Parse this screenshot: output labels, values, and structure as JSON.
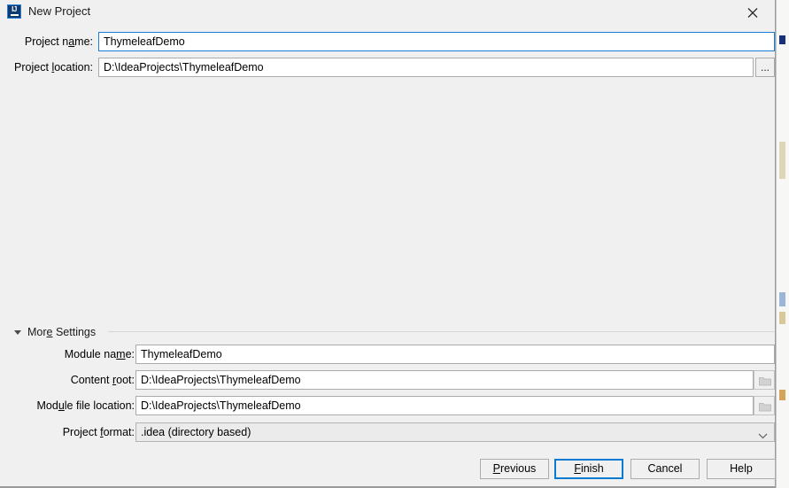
{
  "window": {
    "title": "New Project",
    "icon": "intellij-idea-icon",
    "close_icon": "close-icon",
    "background_color": "#f0f0f0",
    "accent_color": "#0a7ad1"
  },
  "top_fields": [
    {
      "label_before": "Project n",
      "label_mnemonic": "a",
      "label_after": "me:",
      "value": "ThymeleafDemo",
      "focused": true
    },
    {
      "label_before": "Project ",
      "label_mnemonic": "l",
      "label_after": "ocation:",
      "value": "D:\\IdeaProjects\\ThymeleafDemo",
      "focused": false
    }
  ],
  "browse_button": {
    "label": "...",
    "icon": "ellipsis-icon"
  },
  "more_settings": {
    "label_before": "Mor",
    "label_mnemonic": "e",
    "label_after": " Settings",
    "expanded": true,
    "triangle_icon": "triangle-down-icon",
    "fields": [
      {
        "label_before": "Module na",
        "label_mnemonic": "m",
        "label_after": "e:",
        "value": "ThymeleafDemo",
        "has_folder_button": false
      },
      {
        "label_before": "Content ",
        "label_mnemonic": "r",
        "label_after": "oot:",
        "value": "D:\\IdeaProjects\\ThymeleafDemo",
        "has_folder_button": true
      },
      {
        "label_before": "Mod",
        "label_mnemonic": "u",
        "label_after": "le file location:",
        "value": "D:\\IdeaProjects\\ThymeleafDemo",
        "has_folder_button": true
      }
    ],
    "project_format": {
      "label_before": "Project ",
      "label_mnemonic": "f",
      "label_after": "ormat:",
      "selected": ".idea (directory based)",
      "arrow_icon": "chevron-down-icon"
    }
  },
  "footer_buttons": [
    {
      "before": "",
      "mnemonic": "P",
      "after": "revious",
      "default": false,
      "name": "previous-button"
    },
    {
      "before": "",
      "mnemonic": "F",
      "after": "inish",
      "default": true,
      "name": "finish-button"
    },
    {
      "before": "Cancel",
      "mnemonic": "",
      "after": "",
      "default": false,
      "name": "cancel-button"
    },
    {
      "before": "Help",
      "mnemonic": "",
      "after": "",
      "default": false,
      "name": "help-button"
    }
  ]
}
